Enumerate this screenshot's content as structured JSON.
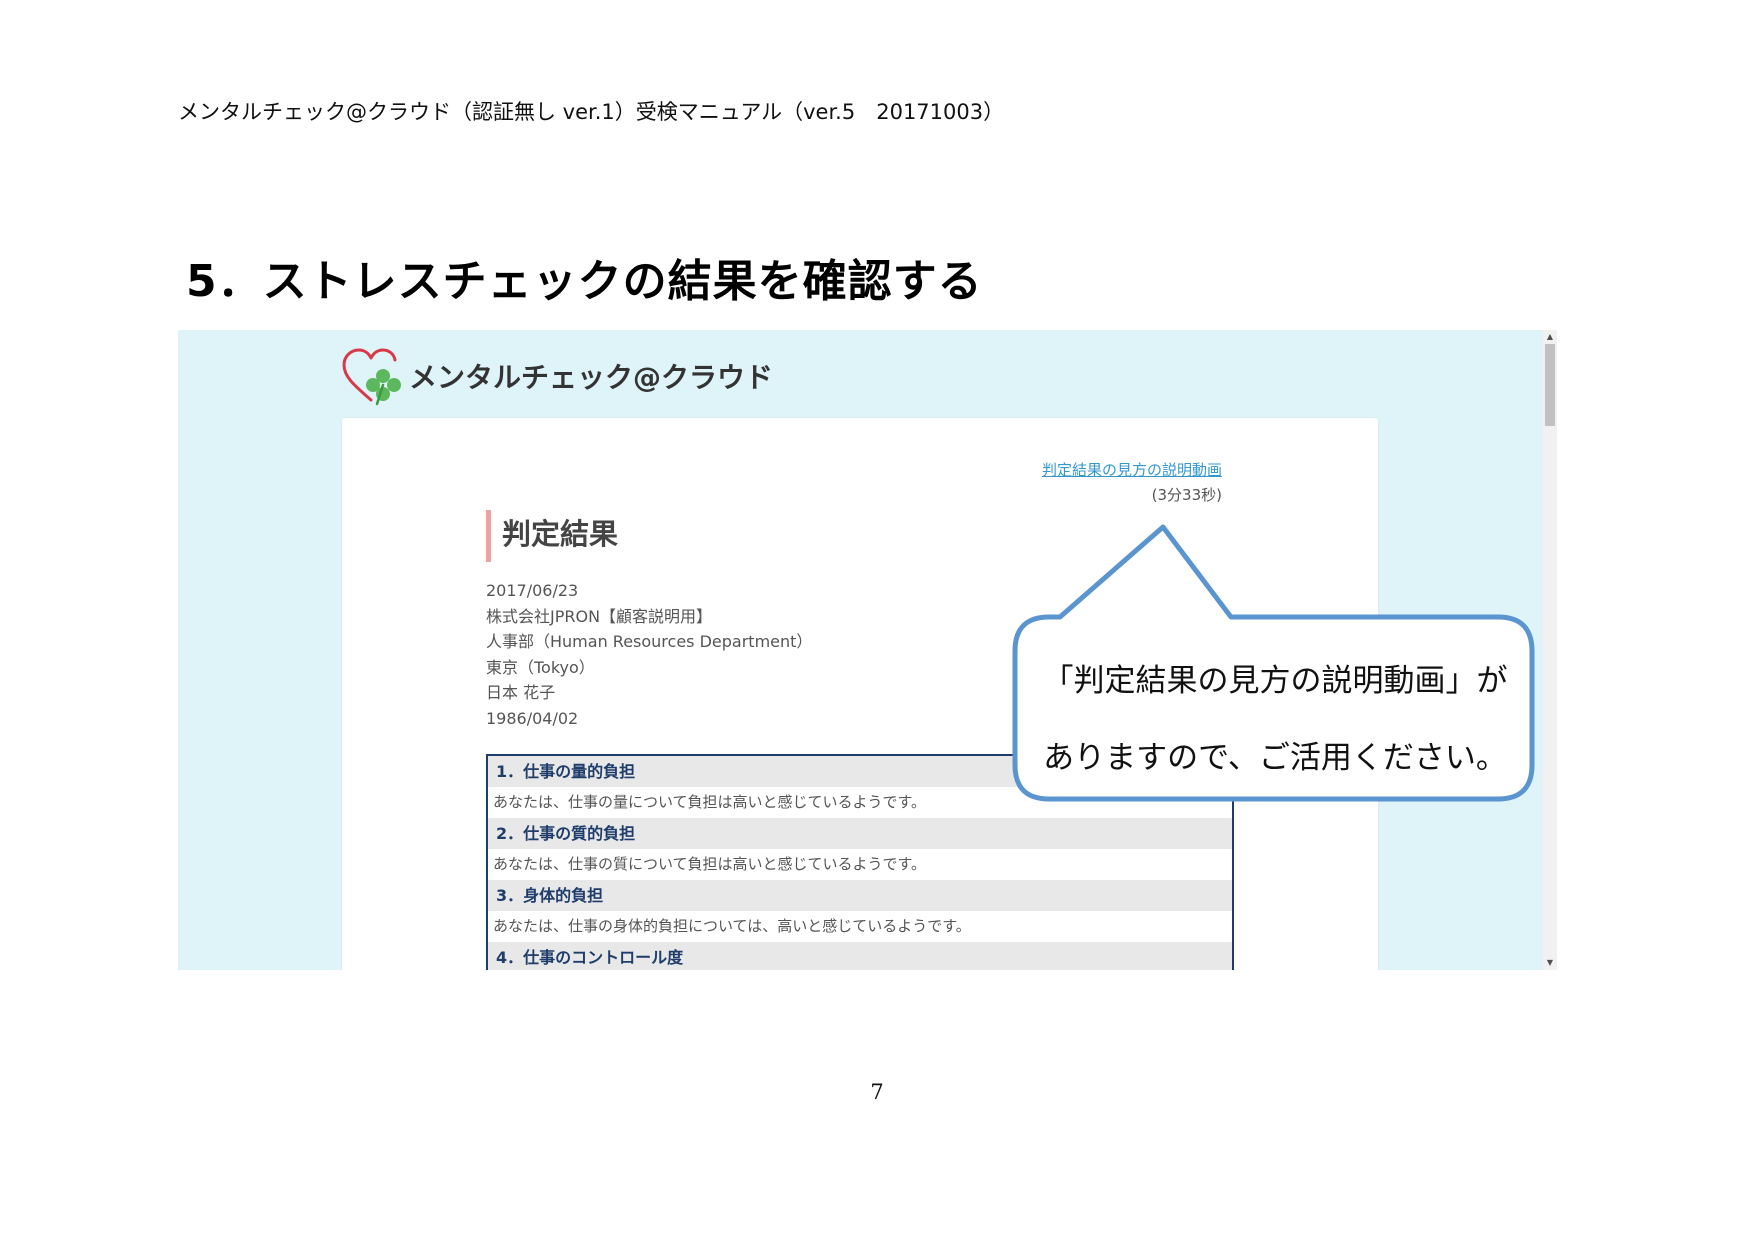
{
  "document": {
    "header": "メンタルチェック@クラウド（認証無し ver.1）受検マニュアル（ver.5　20171003）",
    "section_title": "5．ストレスチェックの結果を確認する",
    "page_number": "7"
  },
  "app": {
    "logo_text": "メンタルチェック@クラウド",
    "video_link": "判定結果の見方の説明動画",
    "video_duration": "(3分33秒)",
    "result_heading": "判定結果",
    "meta": {
      "date": "2017/06/23",
      "company": "株式会社JPRON【顧客説明用】",
      "department": "人事部（Human Resources Department）",
      "location": "東京（Tokyo）",
      "name": "日本 花子",
      "birthdate": "1986/04/02"
    },
    "results": [
      {
        "heading": "1．仕事の量的負担",
        "text": "あなたは、仕事の量について負担は高いと感じているようです。"
      },
      {
        "heading": "2．仕事の質的負担",
        "text": "あなたは、仕事の質について負担は高いと感じているようです。"
      },
      {
        "heading": "3．身体的負担",
        "text": "あなたは、仕事の身体的負担については、高いと感じているようです。"
      },
      {
        "heading": "4．仕事のコントロール度"
      }
    ]
  },
  "callout": {
    "line1": "「判定結果の見方の説明動画」が",
    "line2": "ありますので、ご活用ください。"
  },
  "colors": {
    "page_background": "#ffffff",
    "screenshot_background": "#dff4f9",
    "link": "#3399cc",
    "heading_accent": "#f0a0a0",
    "table_border": "#1f3d6b",
    "table_header_bg": "#e8e8e8",
    "callout_border": "#5b95cf",
    "logo_heart": "#d83848",
    "logo_clover": "#5cb85c"
  },
  "icons": {
    "logo": "heart-clover-icon",
    "scroll_up": "scroll-up-arrow-icon",
    "scroll_down": "scroll-down-arrow-icon"
  }
}
